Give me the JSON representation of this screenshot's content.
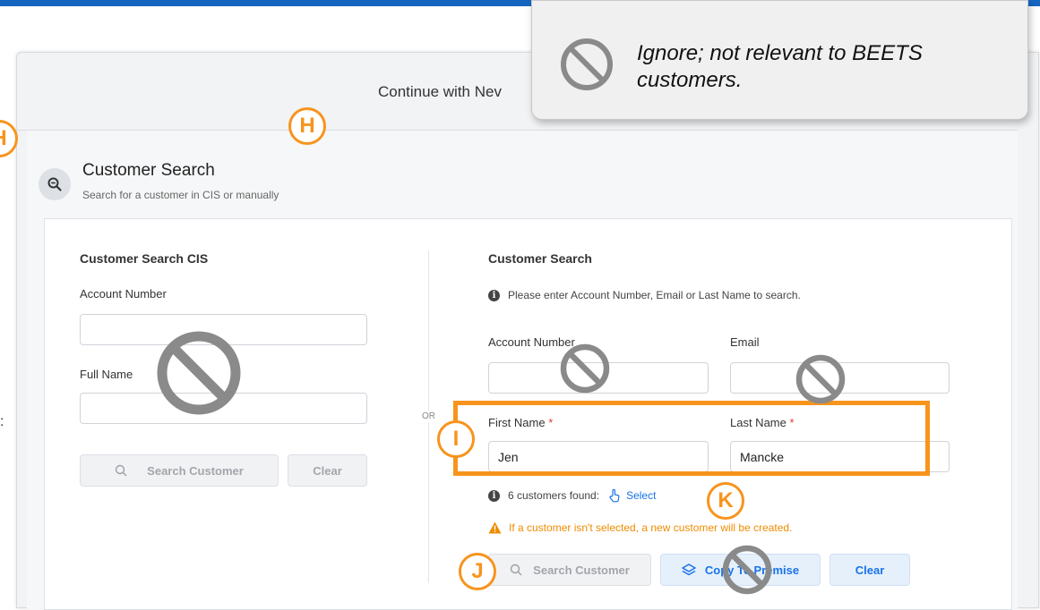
{
  "header": {
    "continue_text": "Continue with Nev"
  },
  "customer_search": {
    "title": "Customer Search",
    "subtitle": "Search for a customer in CIS or manually"
  },
  "cis_panel": {
    "title": "Customer Search CIS",
    "account_number_label": "Account Number",
    "account_number_value": "",
    "full_name_label": "Full Name",
    "full_name_value": "",
    "search_button": "Search Customer",
    "clear_button": "Clear"
  },
  "divider_text": "OR",
  "manual_panel": {
    "title": "Customer Search",
    "info_text": "Please enter Account Number, Email or Last Name to search.",
    "account_number_label": "Account Number",
    "account_number_value": "",
    "email_label": "Email",
    "email_value": "",
    "first_name_label": "First Name",
    "first_name_value": "Jen",
    "last_name_label": "Last Name",
    "last_name_value": "Mancke",
    "required_marker": "*",
    "found_text": "6 customers found:",
    "select_link": "Select",
    "warning_text": "If a customer isn't selected, a new customer will be created.",
    "search_button": "Search Customer",
    "copy_button": "Copy To Premise",
    "clear_button": "Clear"
  },
  "annotations": {
    "tooltip_text": "Ignore; not relevant to BEETS customers.",
    "markers": [
      "H",
      "H",
      "I",
      "J",
      "K"
    ]
  },
  "left_edge_text": ":",
  "colors": {
    "accent_blue": "#1a73e8",
    "annotation_orange": "#f7941d",
    "warning_orange": "#ef8c00",
    "top_bar": "#1565c0"
  }
}
